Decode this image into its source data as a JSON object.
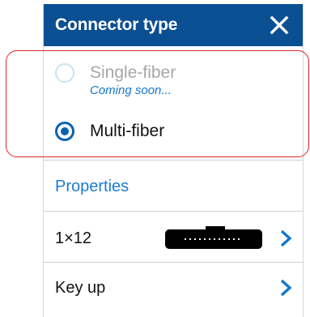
{
  "header": {
    "title": "Connector type",
    "close_icon": "close-icon"
  },
  "connector_options": [
    {
      "label": "Single-fiber",
      "sublabel": "Coming soon...",
      "state": "disabled",
      "selected": false
    },
    {
      "label": "Multi-fiber",
      "state": "enabled",
      "selected": true
    }
  ],
  "properties": {
    "title": "Properties",
    "rows": [
      {
        "label": "1×12",
        "graphic": "mpo-connector-icon",
        "chevron": "chevron-right-icon"
      },
      {
        "label": "Key up",
        "chevron": "chevron-right-icon"
      }
    ]
  },
  "colors": {
    "header_bg": "#0b4f93",
    "accent": "#0b62b3",
    "section_title": "#1c7bd3",
    "disabled_radio": "#c9e3ef",
    "highlight_border": "#d9262a"
  }
}
